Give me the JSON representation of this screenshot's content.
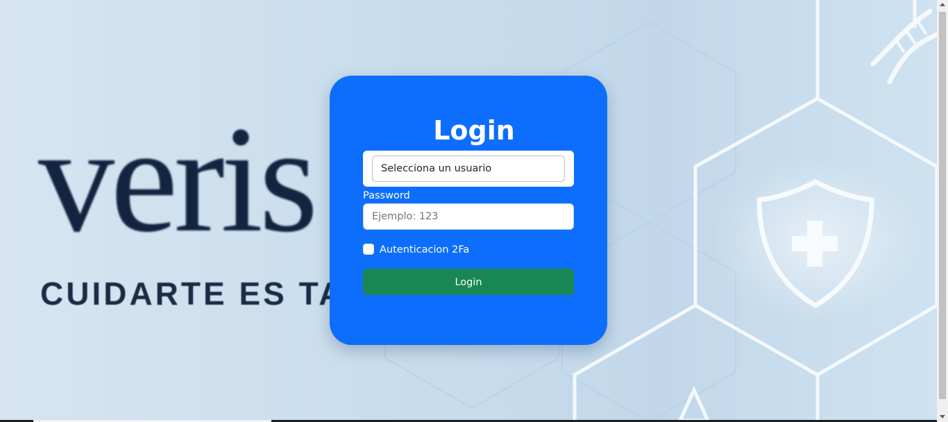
{
  "brand": {
    "logo_text": "veris",
    "tagline": "CUIDARTE ES TA"
  },
  "login": {
    "title": "Login",
    "user_select_value": "Selecciona un usuario",
    "password_label": "Password",
    "password_placeholder": "Ejemplo: 123",
    "twofa_label": "Autenticacion 2Fa",
    "twofa_checked": false,
    "submit_label": "Login"
  },
  "colors": {
    "card": "#0d6efd",
    "button": "#198754",
    "background": "#c8dcec"
  },
  "icons": [
    "shield-cross-icon",
    "dna-icon",
    "hexagon-pattern"
  ]
}
